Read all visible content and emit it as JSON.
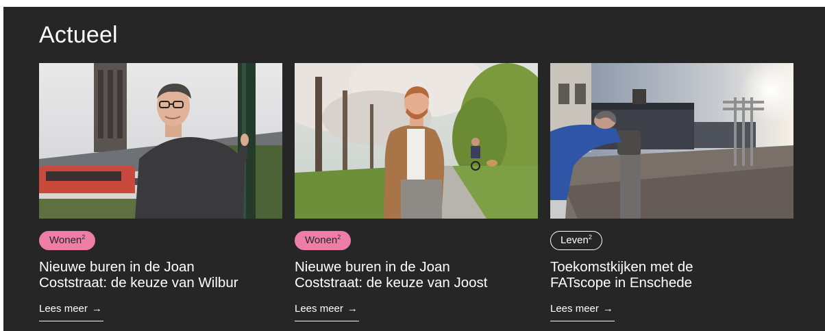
{
  "section": {
    "title": "Actueel"
  },
  "cards": [
    {
      "category": "Wonen",
      "category_sup": "2",
      "title_line1": "Nieuwe buren in de Joan",
      "title_line2": "Coststraat: de keuze van Wilbur",
      "link_label": "Lees meer",
      "link_arrow": "→"
    },
    {
      "category": "Wonen",
      "category_sup": "2",
      "title_line1": "Nieuwe buren in de Joan",
      "title_line2": "Coststraat: de keuze van Joost",
      "link_label": "Lees meer",
      "link_arrow": "→"
    },
    {
      "category": "Leven",
      "category_sup": "2",
      "title_line1": "Toekomstkijken met de",
      "title_line2": "FATscope in Enschede",
      "link_label": "Lees meer",
      "link_arrow": "→"
    }
  ],
  "colors": {
    "background": "#272626",
    "tag_pink": "#ee7ea6",
    "text": "#ffffff"
  }
}
